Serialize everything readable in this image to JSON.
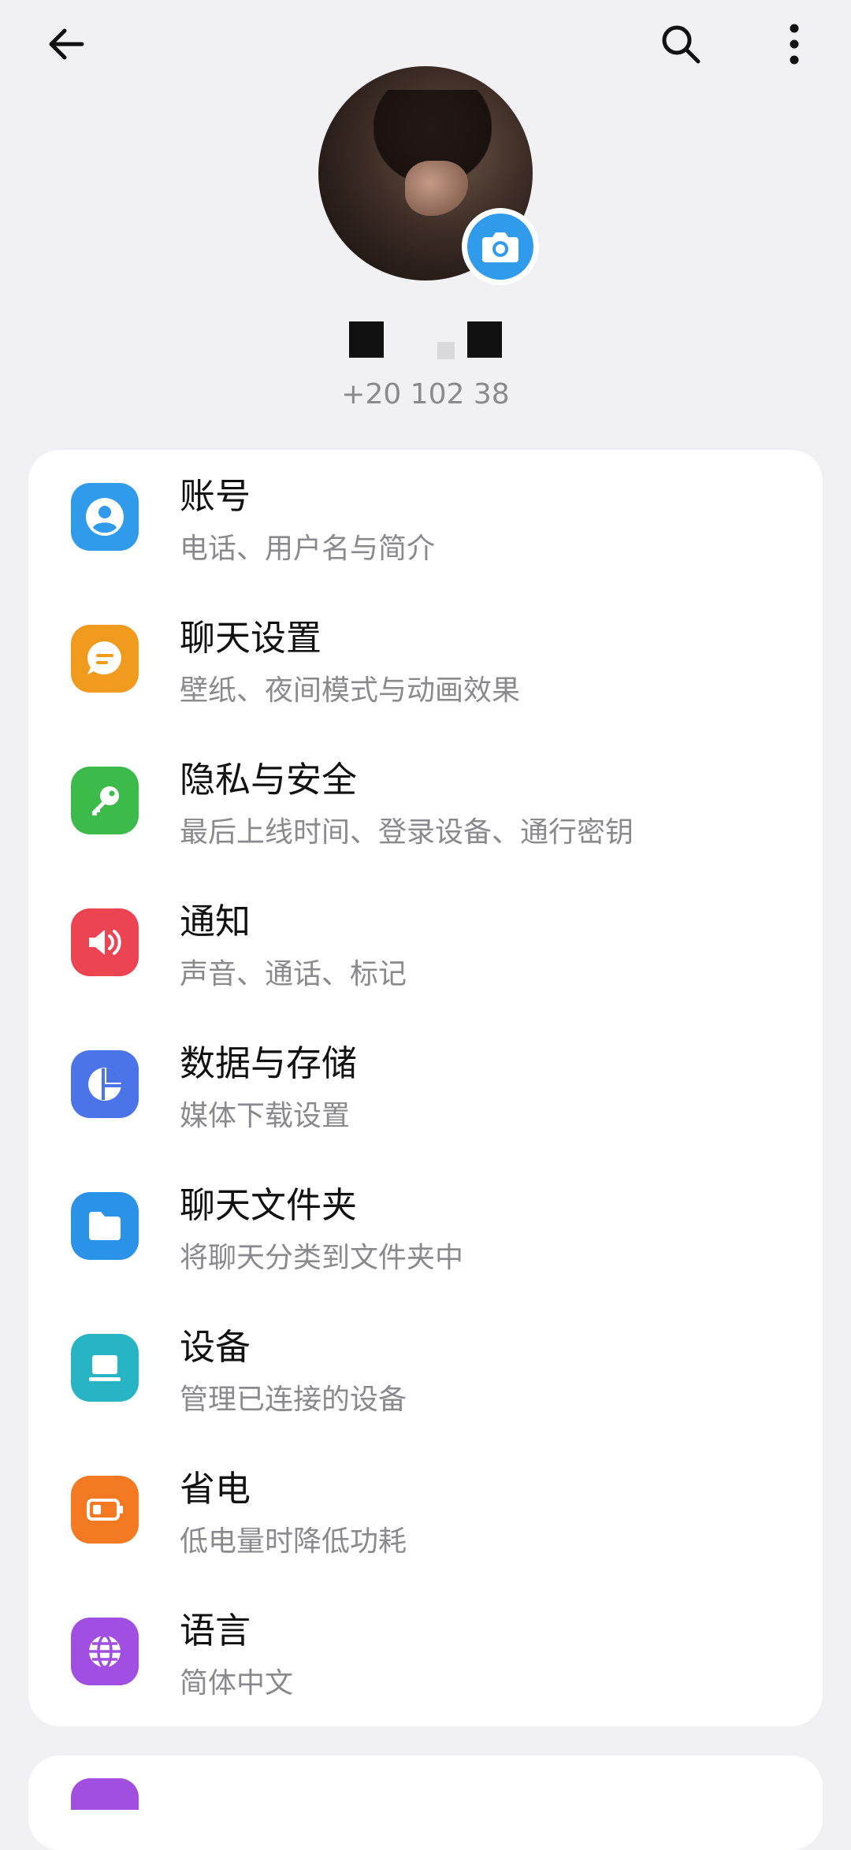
{
  "profile": {
    "phone": "+20 102 38",
    "name_redacted": true
  },
  "colors": {
    "account": "#2f9bea",
    "chat_settings": "#f19b1e",
    "privacy": "#3cba4a",
    "notifications": "#ec4452",
    "data_storage": "#4a74e8",
    "chat_folders": "#2a93e8",
    "devices": "#27b4c4",
    "power_saving": "#f37a22",
    "language": "#a14fe3"
  },
  "settings": [
    {
      "title": "账号",
      "subtitle": "电话、用户名与简介",
      "icon": "person-icon"
    },
    {
      "title": "聊天设置",
      "subtitle": "壁纸、夜间模式与动画效果",
      "icon": "chat-bubble-icon"
    },
    {
      "title": "隐私与安全",
      "subtitle": "最后上线时间、登录设备、通行密钥",
      "icon": "key-icon"
    },
    {
      "title": "通知",
      "subtitle": "声音、通话、标记",
      "icon": "speaker-icon"
    },
    {
      "title": "数据与存储",
      "subtitle": "媒体下载设置",
      "icon": "pie-chart-icon"
    },
    {
      "title": "聊天文件夹",
      "subtitle": "将聊天分类到文件夹中",
      "icon": "folder-icon"
    },
    {
      "title": "设备",
      "subtitle": "管理已连接的设备",
      "icon": "laptop-icon"
    },
    {
      "title": "省电",
      "subtitle": "低电量时降低功耗",
      "icon": "battery-icon"
    },
    {
      "title": "语言",
      "subtitle": "简体中文",
      "icon": "globe-icon"
    }
  ]
}
